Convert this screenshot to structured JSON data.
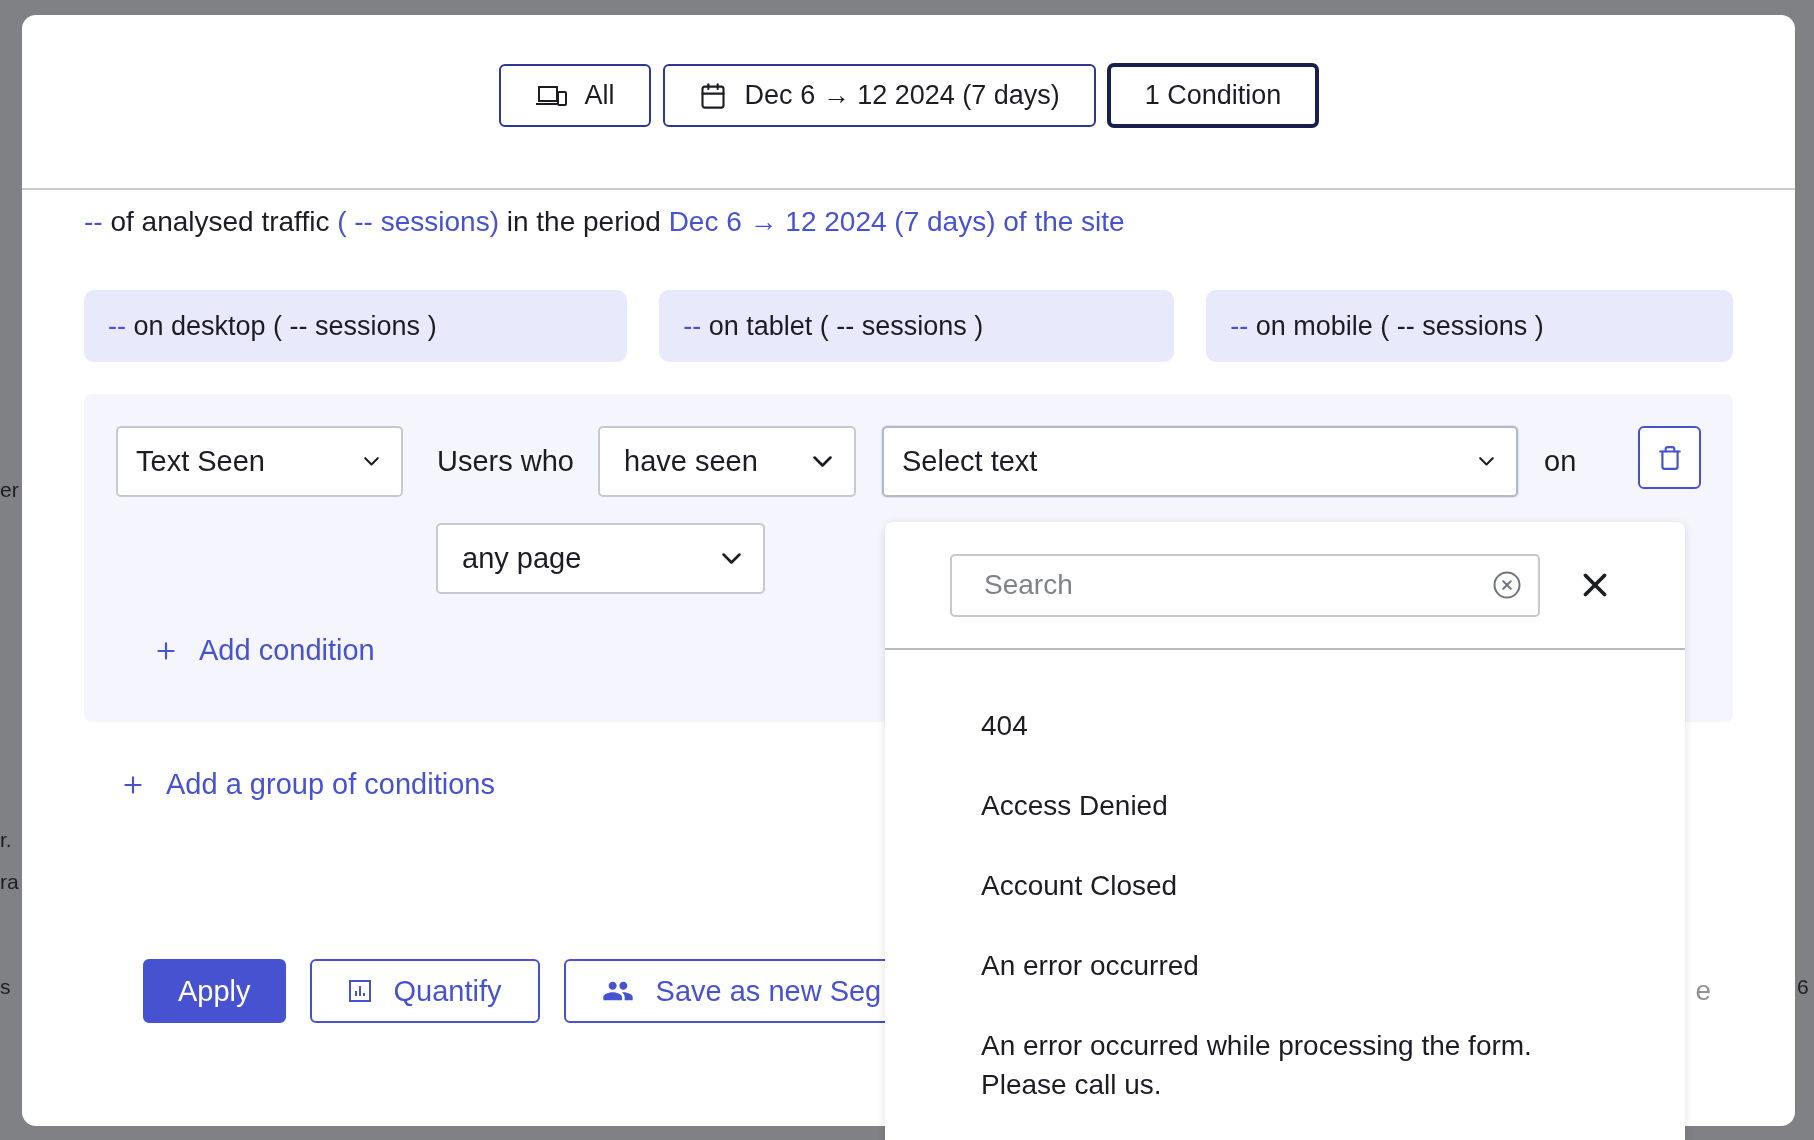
{
  "backdrop": {
    "left_fragments": [
      "er",
      "r.",
      "ra",
      "s"
    ],
    "right_fragments": [
      "6"
    ]
  },
  "toolbar": [
    {
      "kind": "devices",
      "label": "All",
      "selected": false
    },
    {
      "kind": "date",
      "label": "Dec 6 → 12 2024 (7 days)",
      "selected": false
    },
    {
      "kind": "plain",
      "label": "1 Condition",
      "selected": true
    }
  ],
  "summary": [
    {
      "text": "--",
      "highlight": true
    },
    {
      "text": "of analysed traffic",
      "highlight": false
    },
    {
      "text": "( -- sessions)",
      "highlight": true
    },
    {
      "text": "in the period",
      "highlight": false
    },
    {
      "text": "Dec 6 → 12 2024 (7 days) of the site",
      "highlight": true
    }
  ],
  "devices": [
    {
      "value": "--",
      "label": "on desktop ( -- sessions )"
    },
    {
      "value": "--",
      "label": "on tablet ( -- sessions )"
    },
    {
      "value": "--",
      "label": "on mobile ( -- sessions )"
    }
  ],
  "condition_group": {
    "type_select": "Text Seen",
    "users_label": "Users who",
    "verb_select": "have seen",
    "text_select": {
      "placeholder": "Select text",
      "expanded": true
    },
    "on_label": "on",
    "page_select": "any page",
    "add_condition": "Add condition"
  },
  "add_group": "Add a group of conditions",
  "actions": [
    {
      "kind": "primary",
      "label": "Apply"
    },
    {
      "kind": "quantify",
      "label": "Quantify"
    },
    {
      "kind": "segment",
      "label": "Save as new Seg"
    }
  ],
  "footer_fragment": "e",
  "dropdown": {
    "search_placeholder": "Search",
    "options": [
      "404",
      "Access Denied",
      "Account Closed",
      "An error occurred",
      "An error occurred while processing the form. Please call us."
    ]
  }
}
